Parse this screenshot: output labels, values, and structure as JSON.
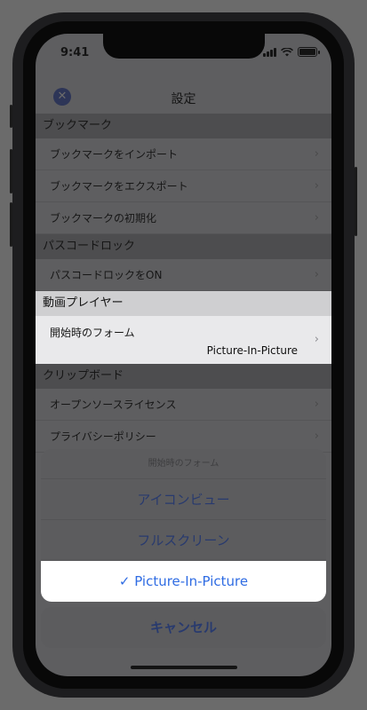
{
  "status": {
    "time": "9:41"
  },
  "nav": {
    "title": "設定",
    "close_icon": "close-circle-icon"
  },
  "sections": {
    "bookmark": {
      "header": "ブックマーク",
      "items": [
        "ブックマークをインポート",
        "ブックマークをエクスポート",
        "ブックマークの初期化"
      ]
    },
    "passcode": {
      "header": "パスコードロック",
      "items": [
        "パスコードロックをON"
      ]
    },
    "video": {
      "header": "動画プレイヤー",
      "start_form_label": "開始時のフォーム",
      "start_form_value": "Picture-In-Picture"
    },
    "clipboard": {
      "header": "クリップボード",
      "items": [
        "オープンソースライセンス",
        "プライバシーポリシー"
      ]
    }
  },
  "action_sheet": {
    "title": "開始時のフォーム",
    "options": [
      "アイコンビュー",
      "フルスクリーン",
      "✓ Picture-In-Picture"
    ],
    "selected_index": 2,
    "cancel": "キャンセル"
  },
  "colors": {
    "accent": "#2f6ce3",
    "dimmed_accent": "#283a6e"
  }
}
